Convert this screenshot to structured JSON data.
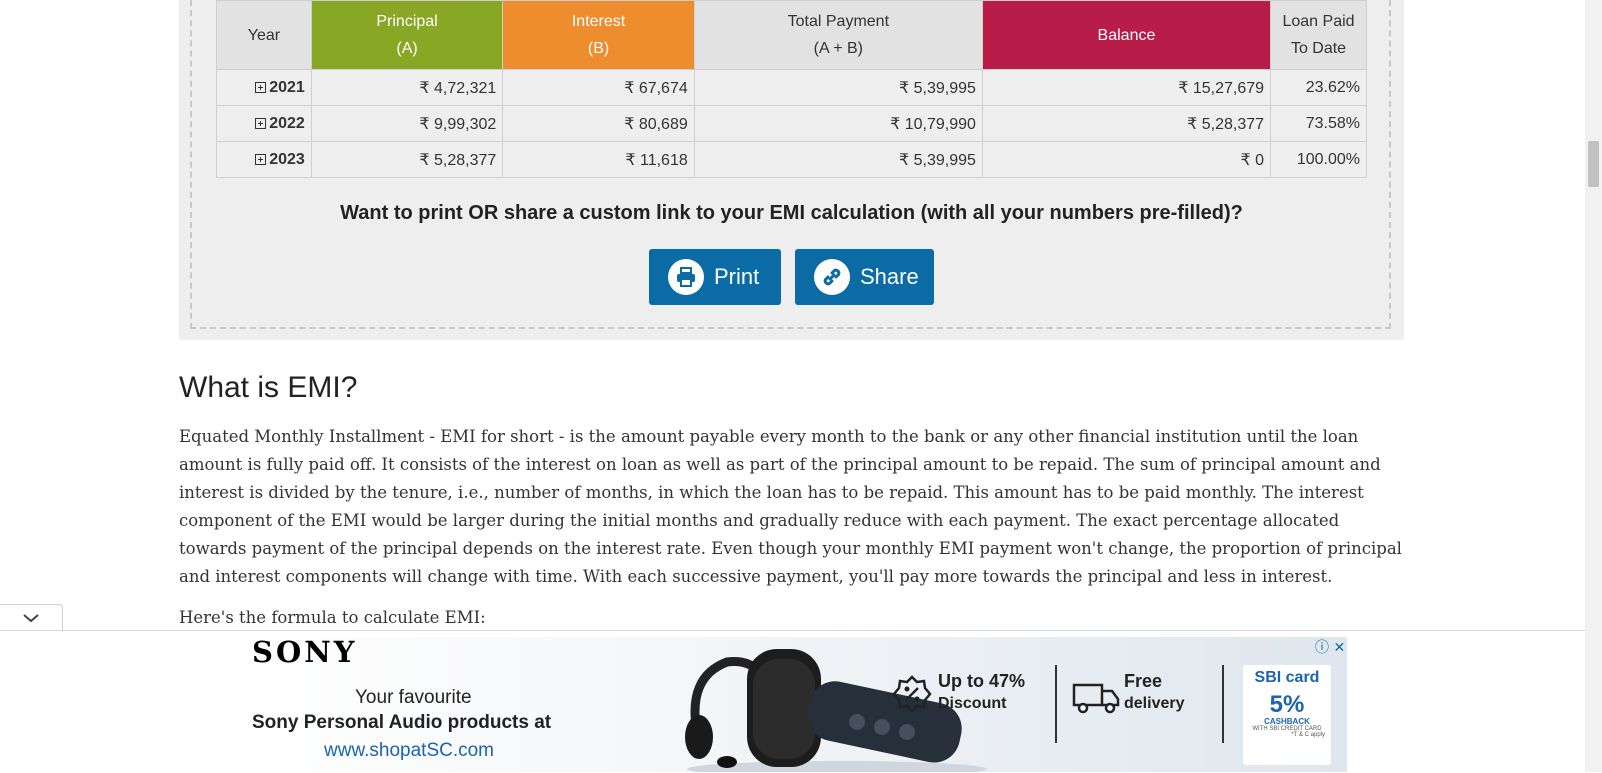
{
  "table": {
    "headers": {
      "year": "Year",
      "principal": "Principal",
      "principal_sub": "(A)",
      "interest": "Interest",
      "interest_sub": "(B)",
      "total": "Total Payment",
      "total_sub": "(A + B)",
      "balance": "Balance",
      "paid": "Loan Paid",
      "paid_sub": "To Date"
    },
    "rows": [
      {
        "year": "2021",
        "principal": "₹ 4,72,321",
        "interest": "₹ 67,674",
        "total": "₹ 5,39,995",
        "balance": "₹ 15,27,679",
        "paid": "23.62%"
      },
      {
        "year": "2022",
        "principal": "₹ 9,99,302",
        "interest": "₹ 80,689",
        "total": "₹ 10,79,990",
        "balance": "₹ 5,28,377",
        "paid": "73.58%"
      },
      {
        "year": "2023",
        "principal": "₹ 5,28,377",
        "interest": "₹ 11,618",
        "total": "₹ 5,39,995",
        "balance": "₹ 0",
        "paid": "100.00%"
      }
    ]
  },
  "share_prompt": "Want to print OR share a custom link to your EMI calculation (with all your numbers pre-filled)?",
  "buttons": {
    "print": "Print",
    "share": "Share"
  },
  "article": {
    "heading": "What is EMI?",
    "paragraph": "Equated Monthly Installment - EMI for short - is the amount payable every month to the bank or any other financial institution until the loan amount is fully paid off. It consists of the interest on loan as well as part of the principal amount to be repaid. The sum of principal amount and interest is divided by the tenure, i.e., number of months, in which the loan has to be repaid. This amount has to be paid monthly. The interest component of the EMI would be larger during the initial months and gradually reduce with each payment. The exact percentage allocated towards payment of the principal depends on the interest rate. Even though your monthly EMI payment won't change, the proportion of principal and interest components will change with time. With each successive payment, you'll pay more towards the principal and less in interest.",
    "formula_intro": "Here's the formula to calculate EMI:"
  },
  "ad": {
    "brand": "SONY",
    "line1": "Your favourite",
    "line2": "Sony Personal Audio products at",
    "line3": "www.shopatSC.com",
    "offer1_top": "Up to 47%",
    "offer1_bottom": "Discount",
    "offer2_top": "Free",
    "offer2_bottom": "delivery",
    "sbi_logo": "SBI card",
    "sbi_pct": "5%",
    "sbi_cashback": "CASHBACK",
    "sbi_sub": "WITH SBI CREDIT CARD",
    "sbi_tc": "*T & C apply",
    "info_icon": "ⓘ",
    "close_icon": "✕"
  },
  "colors": {
    "principal": "#88a825",
    "interest": "#ed8d2e",
    "balance": "#b81d4a",
    "button": "#0b6ba4"
  }
}
